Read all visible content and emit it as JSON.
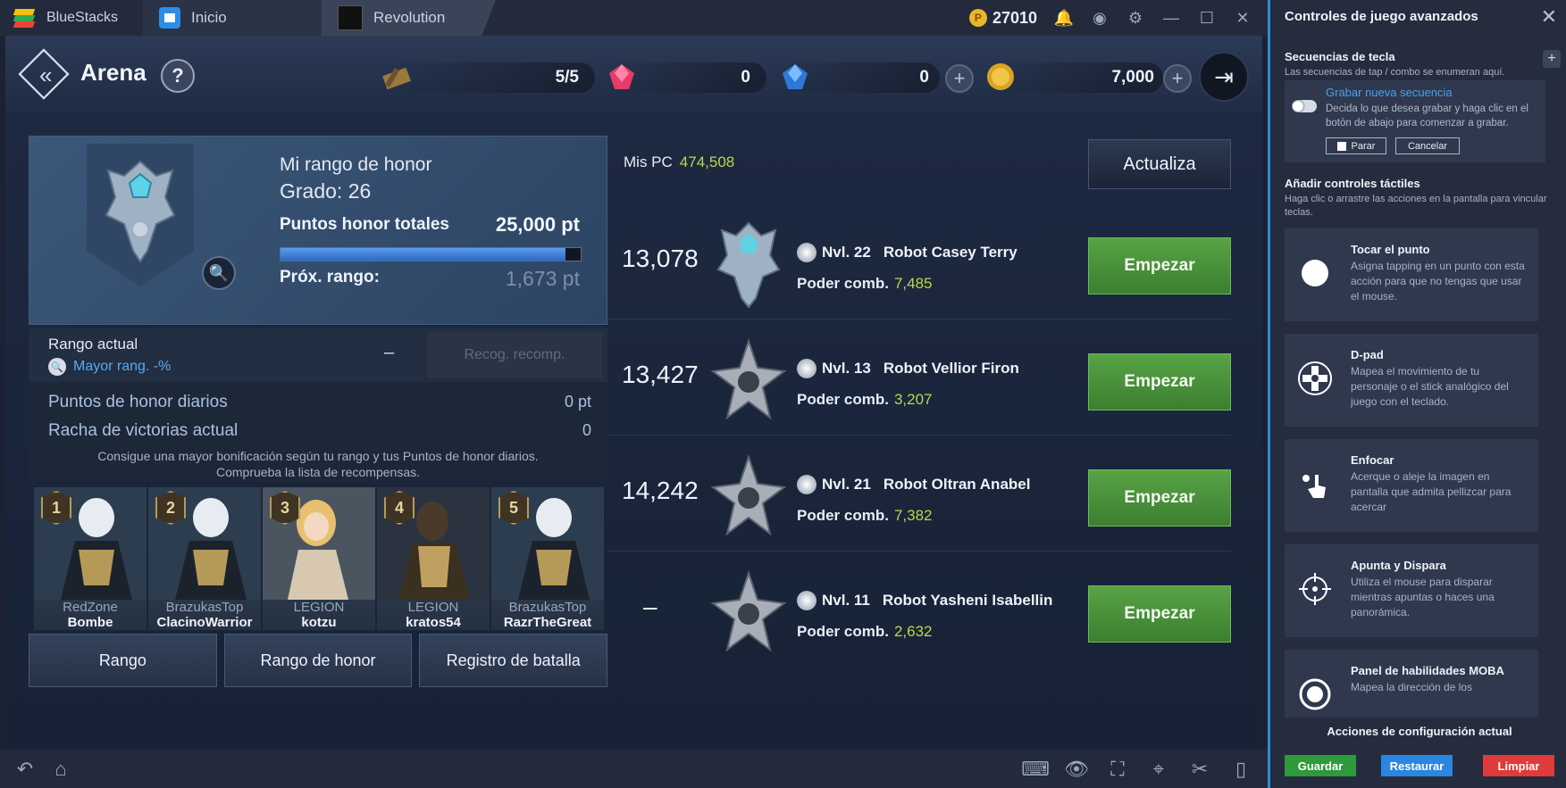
{
  "titlebar": {
    "app_name": "BlueStacks",
    "tabs": [
      {
        "label": "Inicio"
      },
      {
        "label": "Revolution"
      }
    ],
    "coins": "27010",
    "coin_symbol": "P"
  },
  "game": {
    "title": "Arena",
    "help_symbol": "?",
    "resources": {
      "tickets": "5/5",
      "red_gems": "0",
      "blue_gems": "0",
      "gold": "7,000"
    },
    "honor": {
      "my_rank_label": "Mi rango de honor",
      "grade": "Grado: 26",
      "total_label": "Puntos honor totales",
      "total_value": "25,000 pt",
      "progress": 0.95,
      "next_label": "Próx. rango:",
      "next_value": "1,673 pt"
    },
    "stats": {
      "current_rank_label": "Rango actual",
      "current_rank_value": "–",
      "best_rank": "Mayor rang. -%",
      "claim_button": "Recog. recomp.",
      "daily_label": "Puntos de honor diarios",
      "daily_value": "0 pt",
      "streak_label": "Racha de victorias actual",
      "streak_value": "0",
      "hint_line1": "Consigue una mayor bonificación según tu rango y tus Puntos de honor diarios.",
      "hint_line2": "Comprueba la lista de recompensas."
    },
    "top_players": [
      {
        "rank": "1",
        "guild": "RedZone",
        "name": "Bombe"
      },
      {
        "rank": "2",
        "guild": "BrazukasTop",
        "name": "ClacinoWarrior"
      },
      {
        "rank": "3",
        "guild": "LEGION",
        "name": "kotzu"
      },
      {
        "rank": "4",
        "guild": "LEGION",
        "name": "kratos54"
      },
      {
        "rank": "5",
        "guild": "BrazukasTop",
        "name": "RazrTheGreat"
      }
    ],
    "bottom_tabs": [
      "Rango",
      "Rango de honor",
      "Registro de batalla"
    ],
    "my_pc_label": "Mis PC",
    "my_pc_value": "474,508",
    "refresh_button": "Actualiza",
    "opponents": [
      {
        "score": "13,078",
        "level": "Nvl. 22",
        "name": "Robot Casey Terry",
        "power_label": "Poder comb.",
        "power": "7,485",
        "button": "Empezar"
      },
      {
        "score": "13,427",
        "level": "Nvl. 13",
        "name": "Robot Vellior Firon",
        "power_label": "Poder comb.",
        "power": "3,207",
        "button": "Empezar"
      },
      {
        "score": "14,242",
        "level": "Nvl. 21",
        "name": "Robot Oltran Anabel",
        "power_label": "Poder comb.",
        "power": "7,382",
        "button": "Empezar"
      },
      {
        "score": "–",
        "level": "Nvl. 11",
        "name": "Robot Yasheni Isabellin",
        "power_label": "Poder comb.",
        "power": "2,632",
        "button": "Empezar"
      }
    ]
  },
  "sidebar": {
    "title": "Controles de juego avanzados",
    "sequences_title": "Secuencias de tecla",
    "sequences_desc": "Las secuencias de tap / combo se enumeran aquí.",
    "record_link": "Grabar nueva secuencia",
    "record_desc": "Decida lo que desea grabar y haga clic en el botón de abajo para comenzar a grabar.",
    "stop_button": "Parar",
    "cancel_button": "Cancelar",
    "touch_title": "Añadir controles táctiles",
    "touch_desc": "Haga clic o arrastre las acciones en la pantalla para vincular teclas.",
    "controls": [
      {
        "title": "Tocar el punto",
        "desc": "Asigna tapping en un punto con esta acción para que no tengas que usar el mouse.",
        "icon": "tap-icon"
      },
      {
        "title": "D-pad",
        "desc": "Mapea el movimiento de tu personaje o el stick analógico del juego con el teclado.",
        "icon": "dpad-icon"
      },
      {
        "title": "Enfocar",
        "desc": "Acerque o aleje la imagen en pantalla que admita pellizcar para acercar",
        "icon": "zoom-hand-icon"
      },
      {
        "title": "Apunta y Dispara",
        "desc": "Utiliza el mouse para disparar mientras apuntas o haces una panorámica.",
        "icon": "crosshair-icon"
      },
      {
        "title": "Panel de habilidades MOBA",
        "desc": "Mapea la dirección de los",
        "icon": "moba-icon"
      }
    ],
    "footer_title": "Acciones de configuración actual",
    "save": "Guardar",
    "restore": "Restaurar",
    "clear": "Limpiar",
    "colors": {
      "save": "#2e9a3c",
      "restore": "#2a86e0",
      "clear": "#e03a3a",
      "accent": "#2d8bdc"
    }
  }
}
